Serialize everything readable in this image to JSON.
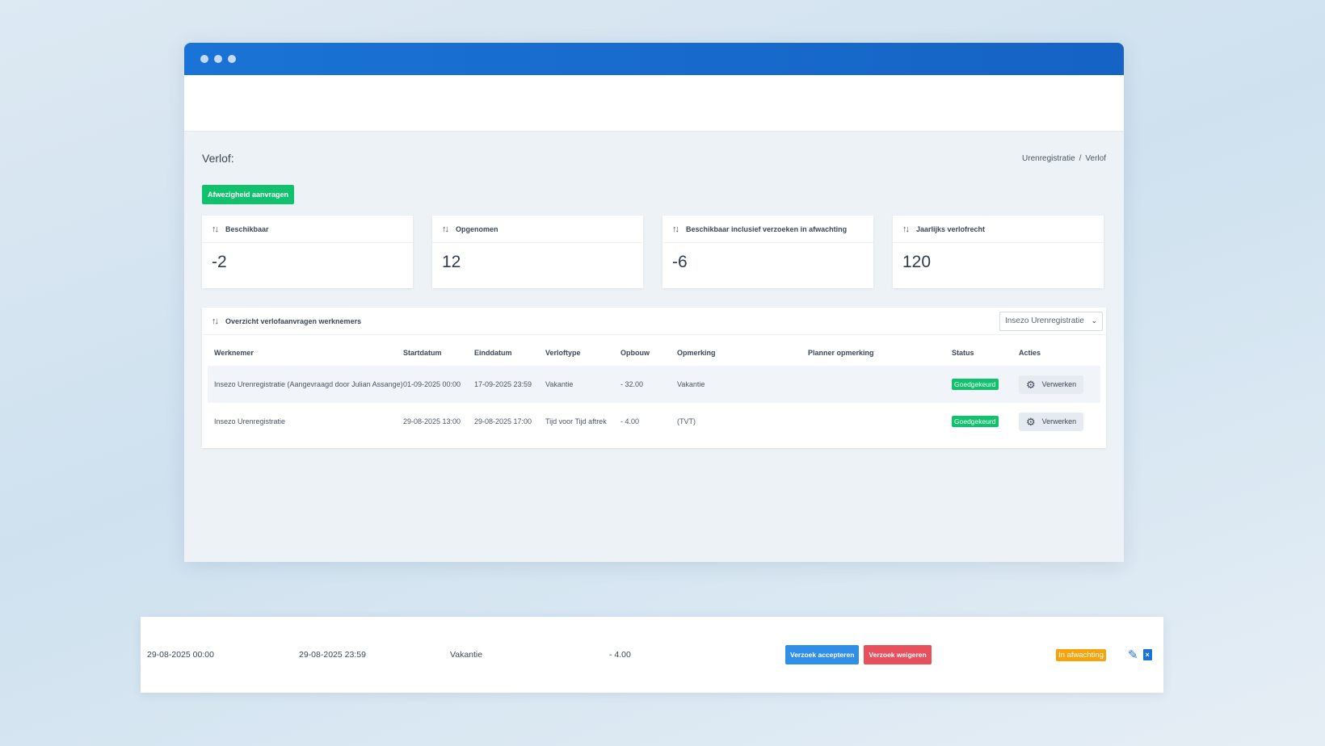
{
  "page": {
    "title": "Verlof:",
    "breadcrumb": [
      "Urenregistratie",
      "/",
      "Verlof"
    ],
    "request_button": "Afwezigheid aanvragen"
  },
  "cards": [
    {
      "label": "Beschikbaar",
      "value": "-2"
    },
    {
      "label": "Opgenomen",
      "value": "12"
    },
    {
      "label": "Beschikbaar inclusief verzoeken in afwachting",
      "value": "-6"
    },
    {
      "label": "Jaarlijks verlofrecht",
      "value": "120"
    }
  ],
  "table": {
    "title": "Overzicht verlofaanvragen werknemers",
    "filter_value": "Insezo Urenregistratie",
    "columns": [
      "Werknemer",
      "Startdatum",
      "Einddatum",
      "Verloftype",
      "Opbouw",
      "Opmerking",
      "Planner opmerking",
      "Status",
      "Acties"
    ],
    "rows": [
      {
        "employee": "Insezo Urenregistratie (Aangevraagd door Julian Assange)",
        "start": "01-09-2025 00:00",
        "end": "17-09-2025 23:59",
        "type": "Vakantie",
        "build": "- 32.00",
        "remark": "Vakantie",
        "planner_remark": "",
        "status": "Goedgekeurd",
        "action": "Verwerken"
      },
      {
        "employee": "Insezo Urenregistratie",
        "start": "29-08-2025 13:00",
        "end": "29-08-2025 17:00",
        "type": "Tijd voor Tijd aftrek",
        "build": "- 4.00",
        "remark": "(TVT)",
        "planner_remark": "",
        "status": "Goedgekeurd",
        "action": "Verwerken"
      }
    ]
  },
  "floating_row": {
    "start": "29-08-2025 00:00",
    "end": "29-08-2025 23:59",
    "type": "Vakantie",
    "build": "- 4.00",
    "accept_button": "Verzoek accepteren",
    "reject_button": "Verzoek weigeren",
    "status": "In afwachting"
  },
  "colors": {
    "titlebar": "#1a73d6",
    "success": "#11c26d",
    "primary": "#2e8ee8",
    "danger": "#e8505b",
    "warning": "#f7a30c"
  },
  "icons": {
    "sort": "sort-arrows-icon",
    "gear": "gear-icon",
    "chevron": "chevron-down-icon",
    "edit": "pencil-icon",
    "delete": "trash-icon"
  }
}
